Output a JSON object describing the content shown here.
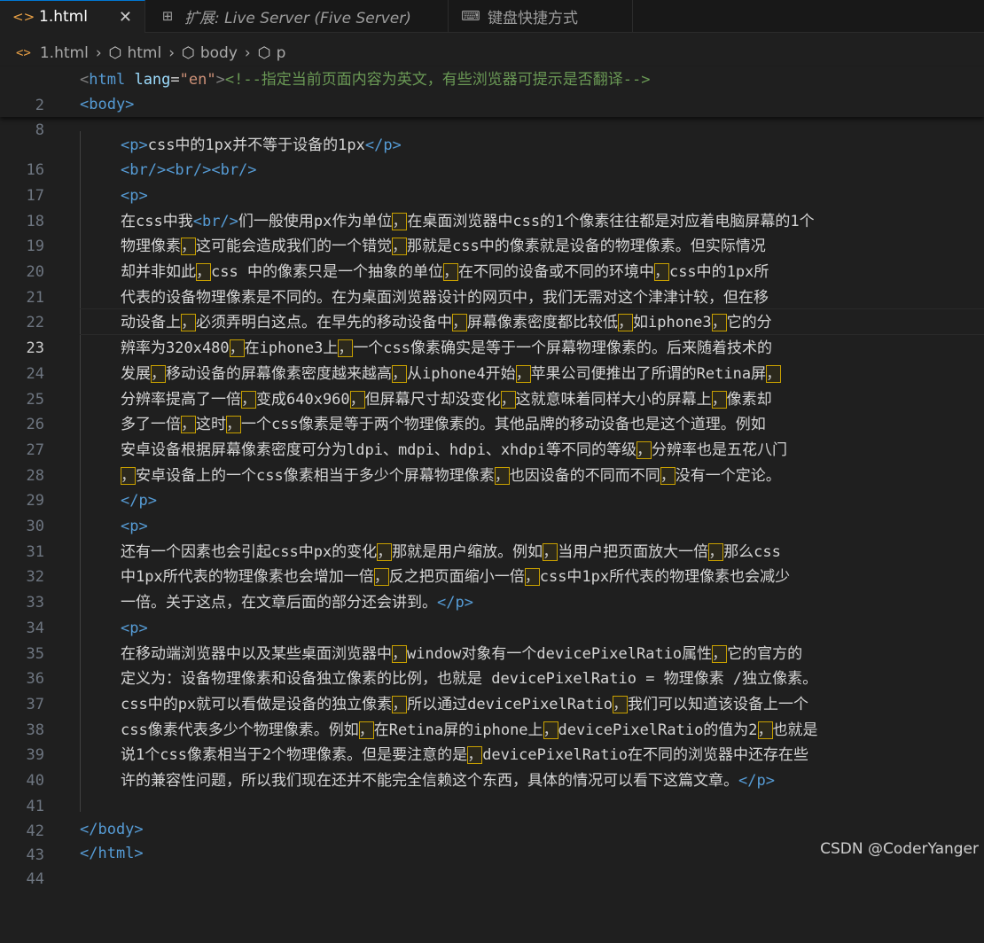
{
  "tabs": [
    {
      "label": "1.html",
      "icon": "html-brackets-icon",
      "glyph": "<>"
    },
    {
      "label": "扩展: Live Server (Five Server)",
      "icon": "extensions-icon",
      "glyph": "⊞"
    },
    {
      "label": "键盘快捷方式",
      "icon": "keyboard-icon",
      "glyph": "⌨"
    }
  ],
  "close_glyph": "✕",
  "breadcrumb": [
    "1.html",
    "html",
    "body",
    "p"
  ],
  "sticky": {
    "l2": "2",
    "html_open": "<html",
    "lang": "lang",
    "eq": "=",
    "lang_val": "\"en\"",
    "gt": ">",
    "comment": "<!--指定当前页面内容为英文，有些浏览器可提示是否翻译-->",
    "l8": "8",
    "body_open": "<body>"
  },
  "line_numbers": [
    "16",
    "17",
    "18",
    "19",
    "20",
    "21",
    "22",
    "23",
    "24",
    "25",
    "26",
    "27",
    "28",
    "29",
    "30",
    "31",
    "32",
    "33",
    "34",
    "35",
    "36",
    "37",
    "38",
    "39",
    "40",
    "41",
    "42",
    "43",
    "44"
  ],
  "current_line": "23",
  "code": {
    "l16_a": "<p>",
    "l16_b": "css中的1px并不等于设备的1px",
    "l16_c": "</p>",
    "l17": "<br/><br/><br/>",
    "l18": "<p>",
    "l19_a": "在css中我",
    "l19_br": "<br/>",
    "l19_b": "们一般使用px作为单位",
    "l19_c": "在桌面浏览器中css的1个像素往往都是对应着电脑屏幕的1个",
    "l20_a": "物理像素",
    "l20_b": "这可能会造成我们的一个错觉",
    "l20_c": "那就是css中的像素就是设备的物理像素。但实际情况",
    "l21_a": "却并非如此",
    "l21_b": "css 中的像素只是一个抽象的单位",
    "l21_c": "在不同的设备或不同的环境中",
    "l21_d": "css中的1px所",
    "l22": "代表的设备物理像素是不同的。在为桌面浏览器设计的网页中，我们无需对这个津津计较，但在移",
    "l23_a": "动设备上",
    "l23_b": "必须弄明白这点。在早先的移动设备中",
    "l23_c": "屏幕像素密度都比较低",
    "l23_d": "如iphone3",
    "l23_e": "它的分",
    "l24_a": "辨率为320x480",
    "l24_b": "在iphone3上",
    "l24_c": "一个css像素确实是等于一个屏幕物理像素的。后来随着技术的",
    "l25_a": "发展",
    "l25_b": "移动设备的屏幕像素密度越来越高",
    "l25_c": "从iphone4开始",
    "l25_d": "苹果公司便推出了所谓的Retina屏",
    "l26_a": "分辨率提高了一倍",
    "l26_b": "变成640x960",
    "l26_c": "但屏幕尺寸却没变化",
    "l26_d": "这就意味着同样大小的屏幕上",
    "l26_e": "像素却",
    "l27_a": "多了一倍",
    "l27_b": "这时",
    "l27_c": "一个css像素是等于两个物理像素的。其他品牌的移动设备也是这个道理。例如",
    "l28_a": "安卓设备根据屏幕像素密度可分为ldpi、mdpi、hdpi、xhdpi等不同的等级",
    "l28_b": "分辨率也是五花八门",
    "l29_a": "安卓设备上的一个css像素相当于多少个屏幕物理像素",
    "l29_b": "也因设备的不同而不同",
    "l29_c": "没有一个定论。",
    "l30": "</p>",
    "l31": "<p>",
    "l32_a": "还有一个因素也会引起css中px的变化",
    "l32_b": "那就是用户缩放。例如",
    "l32_c": "当用户把页面放大一倍",
    "l32_d": "那么css",
    "l33_a": "中1px所代表的物理像素也会增加一倍",
    "l33_b": "反之把页面缩小一倍",
    "l33_c": "css中1px所代表的物理像素也会减少",
    "l34_a": "一倍。关于这点，在文章后面的部分还会讲到。",
    "l34_b": "</p>",
    "l35": "<p>",
    "l36_a": "在移动端浏览器中以及某些桌面浏览器中",
    "l36_b": "window对象有一个devicePixelRatio属性",
    "l36_c": "它的官方的",
    "l37": "定义为：设备物理像素和设备独立像素的比例，也就是 devicePixelRatio = 物理像素 /独立像素。",
    "l38_a": "css中的px就可以看做是设备的独立像素",
    "l38_b": "所以通过devicePixelRatio",
    "l38_c": "我们可以知道该设备上一个",
    "l39_a": "css像素代表多少个物理像素。例如",
    "l39_b": "在Retina屏的iphone上",
    "l39_c": "devicePixelRatio的值为2",
    "l39_d": "也就是",
    "l40_a": "说1个css像素相当于2个物理像素。但是要注意的是",
    "l40_b": "devicePixelRatio在不同的浏览器中还存在些",
    "l41_a": "许的兼容性问题，所以我们现在还并不能完全信赖这个东西，具体的情况可以看下这篇文章。",
    "l41_b": "</p>",
    "l43": "</body>",
    "l44": "</html>"
  },
  "highlight_char": "，",
  "watermark": "CSDN @CoderYanger",
  "colors": {
    "tag": "#569cd6",
    "attr": "#9cdcfe",
    "string": "#ce9178",
    "comment": "#6a9955",
    "highlight_border": "#c8a000",
    "tab_accent": "#0078d4"
  }
}
